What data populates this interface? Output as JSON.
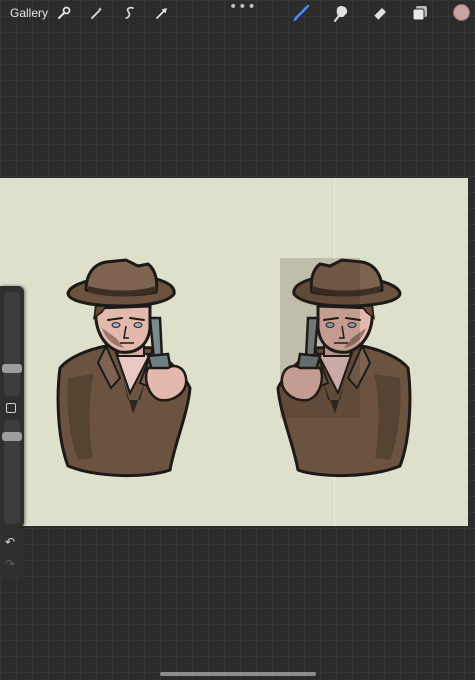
{
  "topbar": {
    "gallery_label": "Gallery",
    "left_tools": [
      "wrench-icon",
      "magic-wand-icon",
      "selection-icon",
      "transform-arrow-icon"
    ],
    "right_tools": [
      "brush-icon",
      "smudge-icon",
      "eraser-icon",
      "layers-icon"
    ],
    "active_tool": "brush-icon",
    "accent_color": "#4a8cff",
    "current_color": "#c9a3a0",
    "more_glyph": "•••"
  },
  "sidebar": {
    "modify_icon": "square-icon",
    "brush_size_level": 0.36,
    "opacity_level": 0.6
  },
  "history": {
    "undo_glyph": "↶",
    "redo_glyph": "↷"
  },
  "canvas": {
    "background_color": "#dfe0cc",
    "artwork": [
      "detective-sticker-left",
      "detective-sticker-right"
    ]
  }
}
